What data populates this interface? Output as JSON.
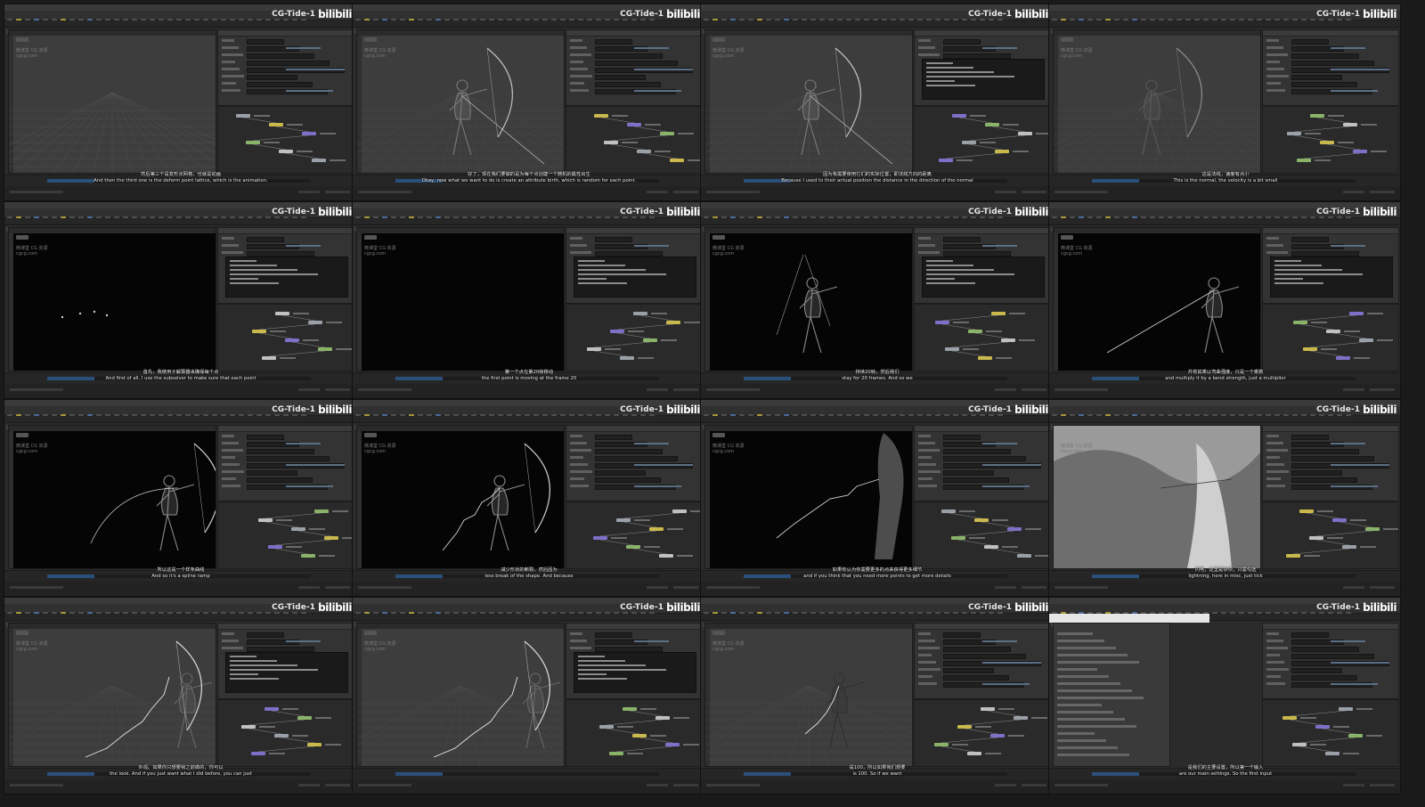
{
  "brand": {
    "channel": "CG-Tide-1",
    "platform": "bilibili"
  },
  "watermark": {
    "lines": [
      "微课堂 CG 资源",
      "cgcg.com"
    ]
  },
  "tiles": [
    {
      "id": 1,
      "viewport": "grid-gray",
      "subtitle_cn": "然后第三个是变形点网格，也就是动画",
      "subtitle_en": "And then the third one is the deform point lattice, which is the animation."
    },
    {
      "id": 2,
      "viewport": "archer-bow-gray",
      "subtitle_cn": "好了，现在我们要做的是为每个点创建一个随机的属性出生",
      "subtitle_en": "Okay, now what we want to do is create an attribute birth, which is random for each point."
    },
    {
      "id": 3,
      "viewport": "archer-bow-gray",
      "subtitle_cn": "因为我需要使用它们的实际位置，即法线方向的距离",
      "subtitle_en": "Because I used to their actual position the distance in the direction of the normal"
    },
    {
      "id": 4,
      "viewport": "archer-faint",
      "subtitle_cn": "这是法线，速度有点小",
      "subtitle_en": "This is the normal, the velocity is a bit small"
    },
    {
      "id": 5,
      "viewport": "dark-points",
      "subtitle_cn": "首先，我使用子解算器来确保每个点",
      "subtitle_en": "And first of all, I use the subsolver to make sure that each point"
    },
    {
      "id": 6,
      "viewport": "dark-empty",
      "subtitle_cn": "第一个点在第20帧移动",
      "subtitle_en": "the first point is moving at the frame 20"
    },
    {
      "id": 7,
      "viewport": "dark-archer",
      "subtitle_cn": "持续20帧，然后我们",
      "subtitle_en": "stay for 20 frames. And so we"
    },
    {
      "id": 8,
      "viewport": "dark-archer-line",
      "subtitle_cn": "并将其乘以弯曲强度，只是一个乘数",
      "subtitle_en": "and multiply it by a bend strength, just a multiplier"
    },
    {
      "id": 9,
      "viewport": "dark-archer-arc",
      "subtitle_cn": "所以这是一个样条曲线",
      "subtitle_en": "And so it's a spline ramp"
    },
    {
      "id": 10,
      "viewport": "dark-archer-lightning",
      "subtitle_cn": "减少形状的断裂，然后因为",
      "subtitle_en": "less break of the shape. And because"
    },
    {
      "id": 11,
      "viewport": "dark-closeup",
      "subtitle_cn": "如果你认为你需要更多的点来获得更多细节",
      "subtitle_en": "and if you think that you need more points to get more details"
    },
    {
      "id": 12,
      "viewport": "render",
      "subtitle_cn": "闪电，这里是杂项，只需勾选",
      "subtitle_en": "lightning, here in misc, just tick"
    },
    {
      "id": 13,
      "viewport": "gray-archer-lightning",
      "subtitle_cn": "外观。如果你只想要我之前做的，你可以",
      "subtitle_en": "the look. And if you just want what I did before, you can just"
    },
    {
      "id": 14,
      "viewport": "gray-archer-lightning",
      "subtitle_cn": "",
      "subtitle_en": ""
    },
    {
      "id": 15,
      "viewport": "gray-archer-dark",
      "subtitle_cn": "是100，所以如果我们想要",
      "subtitle_en": "is 100. So if we want"
    },
    {
      "id": 16,
      "viewport": "dialog",
      "subtitle_cn": "是我们的主要设置，所以第一个输入",
      "subtitle_en": "are our main settings. So the first input"
    }
  ]
}
